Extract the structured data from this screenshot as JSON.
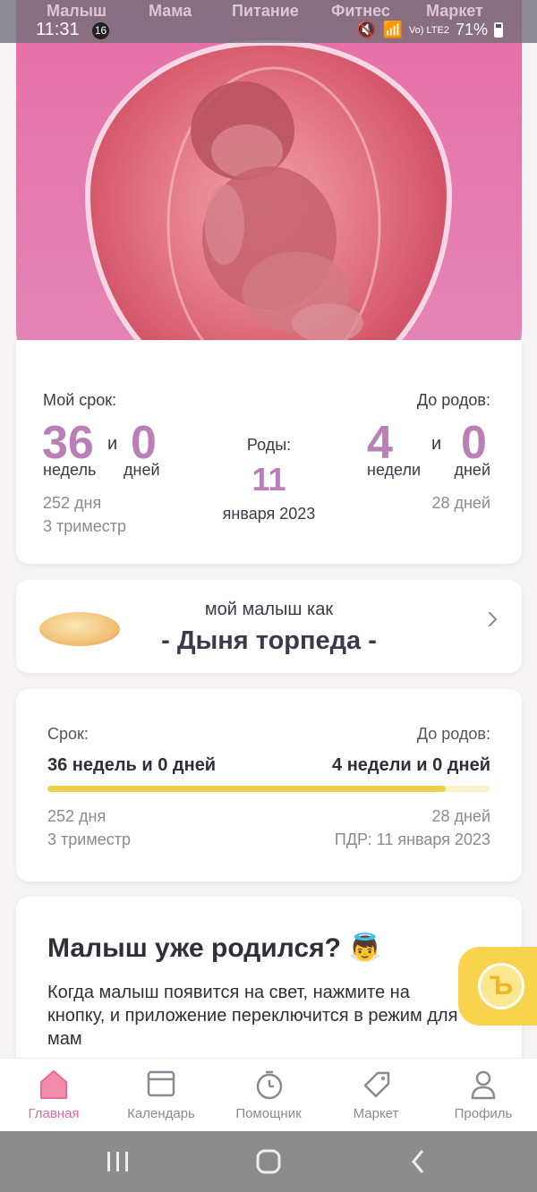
{
  "top_tabs": [
    "Малыш",
    "Мама",
    "Питание",
    "Фитнес",
    "Маркет"
  ],
  "status_bar": {
    "time": "11:31",
    "notification_count": "16",
    "network": "Vo) LTE2",
    "battery": "71%"
  },
  "colors": {
    "accent_pink": "#e66fa6",
    "accent_purple": "#b97fb6",
    "progress_yellow": "#ecd249",
    "coin_yellow": "#f9d34d"
  },
  "term": {
    "my_term_label": "Мой срок:",
    "weeks": "36",
    "and": "и",
    "days": "0",
    "weeks_unit": "недель",
    "days_unit": "дней",
    "total_days": "252 дня",
    "trimester": "3 триместр"
  },
  "birth": {
    "label": "Роды:",
    "day": "11",
    "month_year": "января 2023"
  },
  "until": {
    "label": "До родов:",
    "weeks": "4",
    "and": "и",
    "days": "0",
    "weeks_unit": "недели",
    "days_unit": "дней",
    "total_days": "28 дней"
  },
  "fruit": {
    "subtitle": "мой малыш как",
    "name": "- Дыня торпеда -"
  },
  "progress_card": {
    "term_label": "Срок:",
    "until_label": "До родов:",
    "term_value": "36 недель и 0 дней",
    "until_value": "4 недели и 0 дней",
    "progress_fraction": 0.9,
    "term_days": "252 дня",
    "trimester": "3 триместр",
    "until_days": "28 дней",
    "due_date": "ПДР: 11 января 2023"
  },
  "born_card": {
    "title": "Малыш уже родился? 👼",
    "text": "Когда малыш появится на свет, нажмите на кнопку, и приложение переключится в режим для мам"
  },
  "coin_badge": "Ъ",
  "bottom_nav": [
    {
      "label": "Главная",
      "icon": "home-icon",
      "active": true
    },
    {
      "label": "Календарь",
      "icon": "calendar-icon",
      "active": false
    },
    {
      "label": "Помощник",
      "icon": "timer-icon",
      "active": false
    },
    {
      "label": "Маркет",
      "icon": "tag-icon",
      "active": false
    },
    {
      "label": "Профиль",
      "icon": "profile-icon",
      "active": false
    }
  ]
}
